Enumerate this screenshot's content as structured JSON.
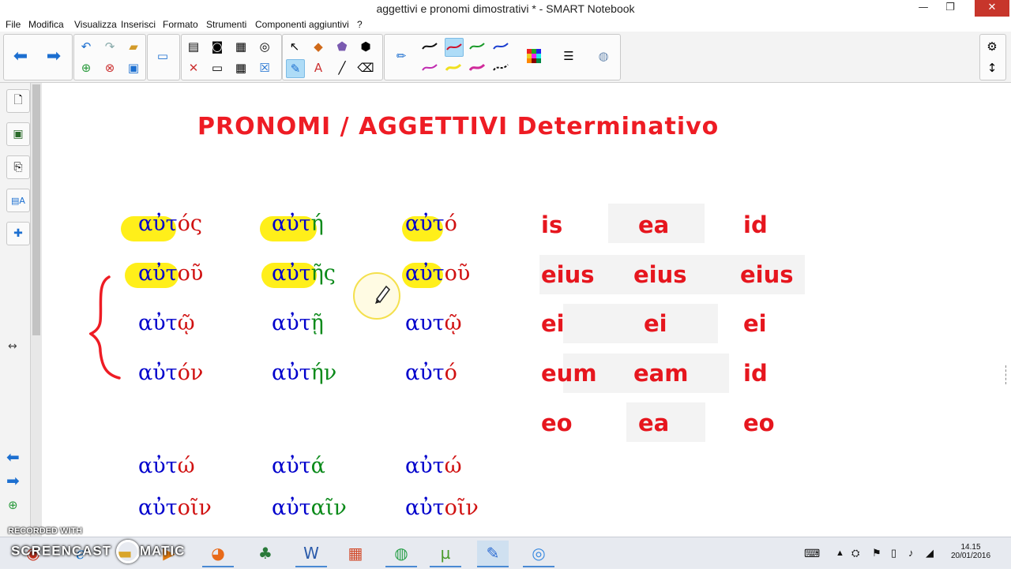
{
  "window": {
    "title": "aggettivi e pronomi dimostrativi * - SMART Notebook"
  },
  "menu": [
    "File",
    "Modifica",
    "Visualizza",
    "Inserisci",
    "Formato",
    "Strumenti",
    "Componenti aggiuntivi",
    "?"
  ],
  "page": {
    "title": "PRONOMI / AGGETTIVI Determinativo",
    "greek_rows": [
      [
        {
          "stem": "αὐτ",
          "end": "ός"
        },
        {
          "stem": "αὐτ",
          "end": "ή"
        },
        {
          "stem": "αὐτ",
          "end": "ό"
        }
      ],
      [
        {
          "stem": "αὐτ",
          "end": "οῦ"
        },
        {
          "stem": "αὐτ",
          "end": "ῆς"
        },
        {
          "stem": "αὐτ",
          "end": "οῦ"
        }
      ],
      [
        {
          "stem": "αὐτ",
          "end": "ῷ"
        },
        {
          "stem": "αὐτ",
          "end": "ῇ"
        },
        {
          "stem": "αυτ",
          "end": "ῷ"
        }
      ],
      [
        {
          "stem": "αὐτ",
          "end": "όν"
        },
        {
          "stem": "αὐτ",
          "end": "ήν"
        },
        {
          "stem": "αὐτ",
          "end": "ό"
        }
      ],
      [
        {
          "stem": "αὐτ",
          "end": "ώ"
        },
        {
          "stem": "αὐτ",
          "end": "ά"
        },
        {
          "stem": "αὐτ",
          "end": "ώ"
        }
      ],
      [
        {
          "stem": "αὐτ",
          "end": "οῖν"
        },
        {
          "stem": "αὐτ",
          "end": "αῖν"
        },
        {
          "stem": "αὐτ",
          "end": "οῖν"
        }
      ]
    ],
    "latin_rows": [
      [
        "is",
        "ea",
        "id"
      ],
      [
        "eius",
        "eius",
        "eius"
      ],
      [
        "ei",
        "ei",
        "ei"
      ],
      [
        "eum",
        "eam",
        "id"
      ],
      [
        "eo",
        "ea",
        "eo"
      ]
    ]
  },
  "watermark": {
    "line1": "RECORDED WITH",
    "line2": "SCREENCAST",
    "line3": "MATIC"
  },
  "tray": {
    "time": "14.15",
    "date": "20/01/2016"
  },
  "colors": {
    "title_red": "#ee1c24",
    "greek_blue": "#0000cc",
    "greek_red": "#d01010",
    "greek_green": "#0b8a1a",
    "highlight": "#ffef1a",
    "latin_red": "#e6161e"
  }
}
